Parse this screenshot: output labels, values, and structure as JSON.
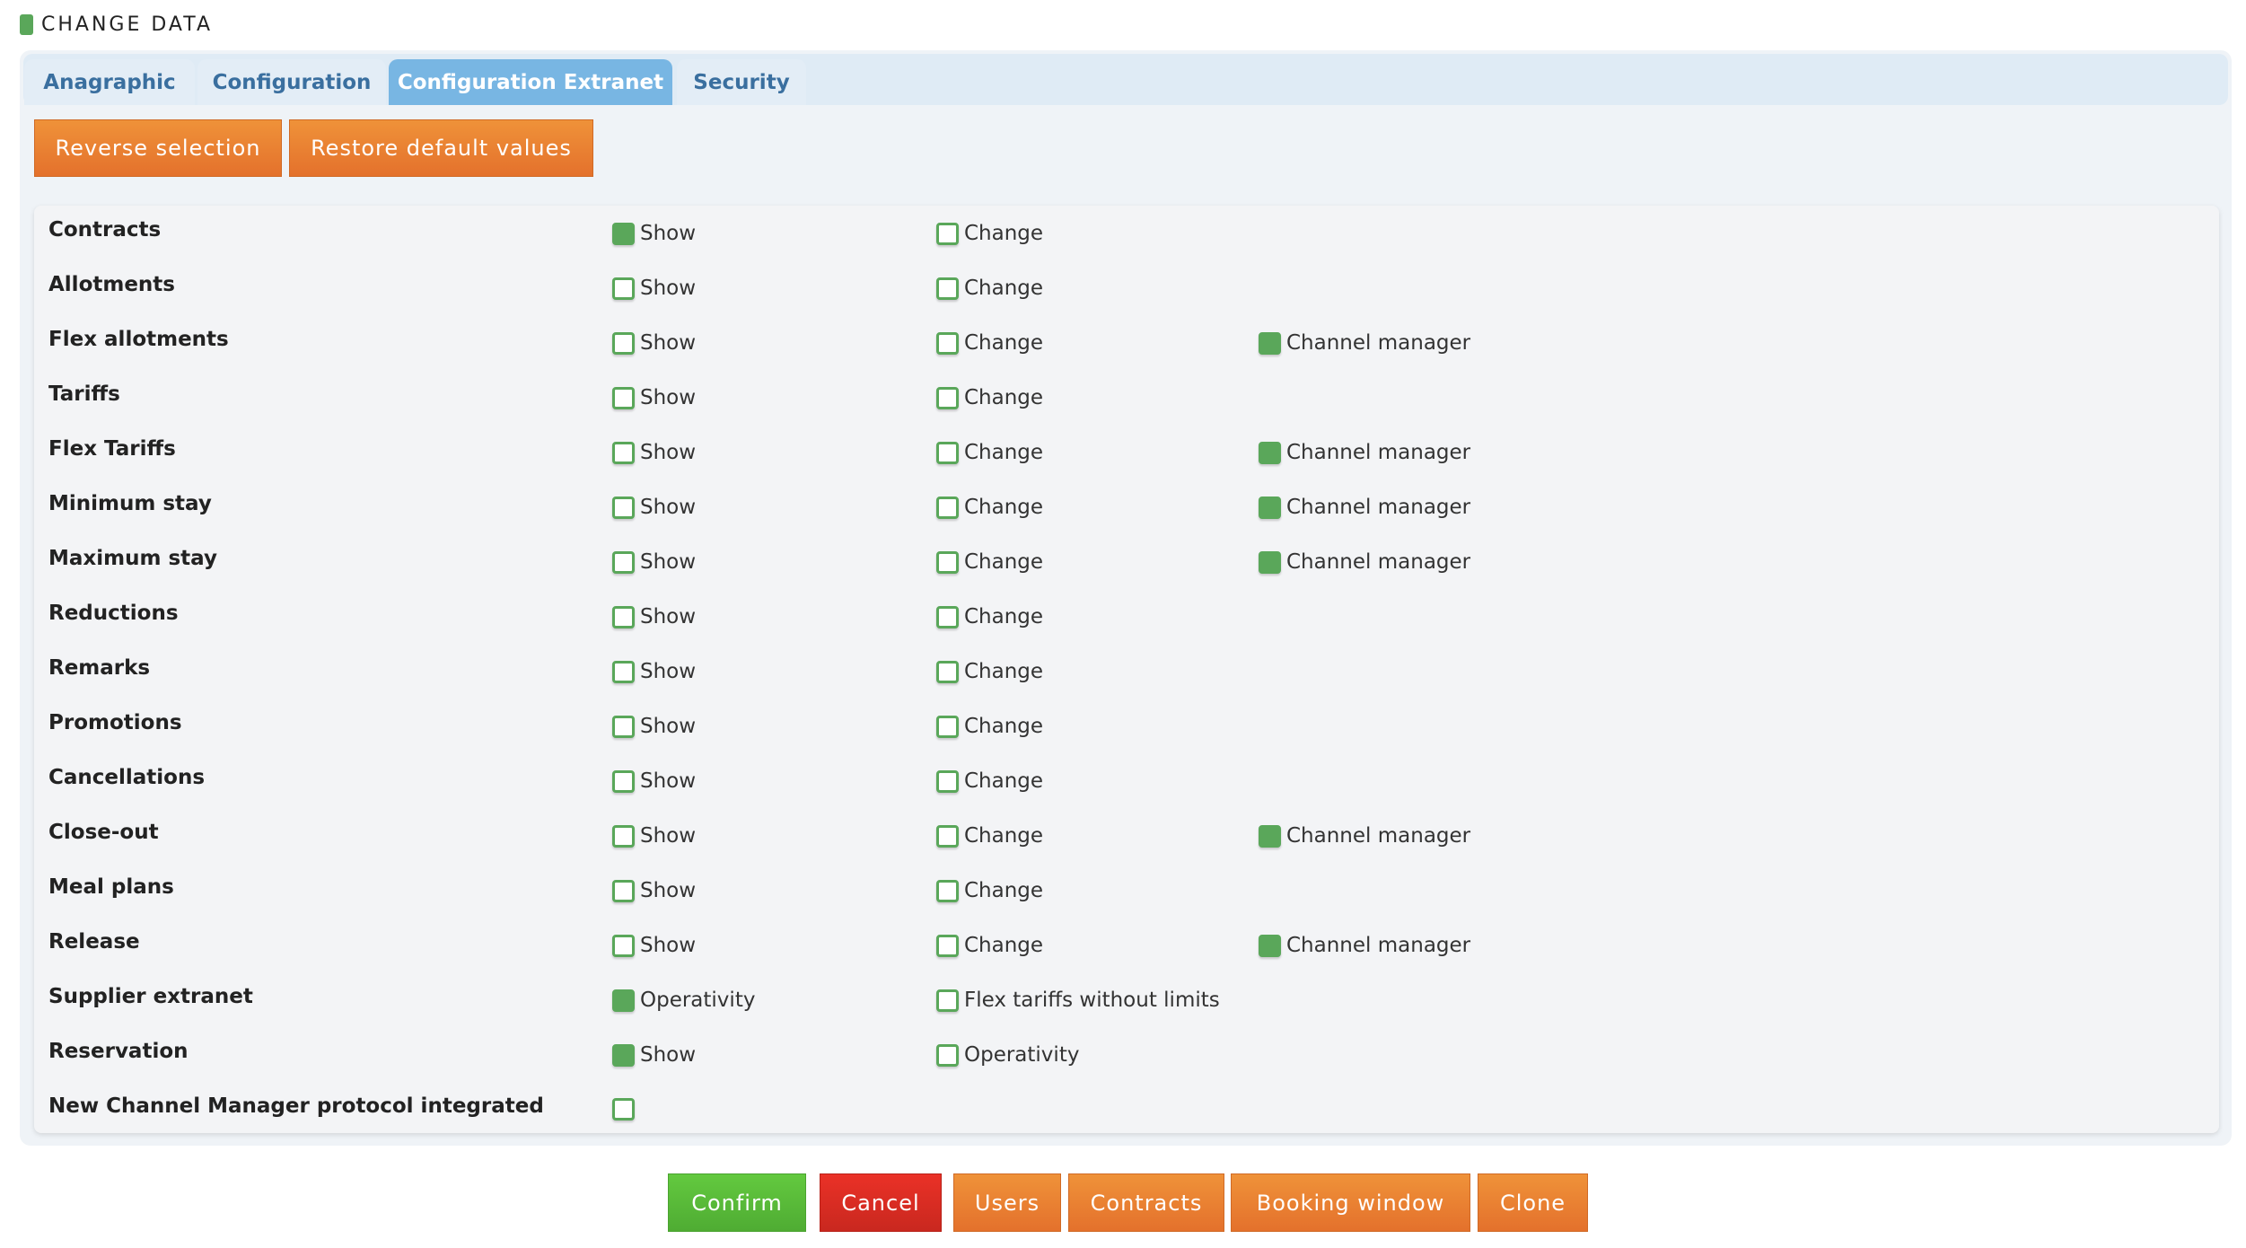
{
  "header": {
    "title": "CHANGE DATA"
  },
  "tabs": [
    {
      "label": "Anagraphic",
      "active": false
    },
    {
      "label": "Configuration",
      "active": false
    },
    {
      "label": "Configuration Extranet",
      "active": true
    },
    {
      "label": "Security",
      "active": false
    }
  ],
  "toolbar": {
    "reverse_selection": "Reverse selection",
    "restore_defaults": "Restore default values"
  },
  "colors": {
    "checkbox": "#5aa75a",
    "tab_active": "#78b6e3",
    "orange": "#e98130",
    "confirm": "#55b737",
    "cancel": "#d62b22"
  },
  "rows": [
    {
      "label": "Contracts",
      "options": [
        {
          "label": "Show",
          "checked": true
        },
        {
          "label": "Change",
          "checked": false
        }
      ]
    },
    {
      "label": "Allotments",
      "options": [
        {
          "label": "Show",
          "checked": false
        },
        {
          "label": "Change",
          "checked": false
        }
      ]
    },
    {
      "label": "Flex allotments",
      "options": [
        {
          "label": "Show",
          "checked": false
        },
        {
          "label": "Change",
          "checked": false
        },
        {
          "label": "Channel manager",
          "checked": true
        }
      ]
    },
    {
      "label": "Tariffs",
      "options": [
        {
          "label": "Show",
          "checked": false
        },
        {
          "label": "Change",
          "checked": false
        }
      ]
    },
    {
      "label": "Flex Tariffs",
      "options": [
        {
          "label": "Show",
          "checked": false
        },
        {
          "label": "Change",
          "checked": false
        },
        {
          "label": "Channel manager",
          "checked": true
        }
      ]
    },
    {
      "label": "Minimum stay",
      "options": [
        {
          "label": "Show",
          "checked": false
        },
        {
          "label": "Change",
          "checked": false
        },
        {
          "label": "Channel manager",
          "checked": true
        }
      ]
    },
    {
      "label": "Maximum stay",
      "options": [
        {
          "label": "Show",
          "checked": false
        },
        {
          "label": "Change",
          "checked": false
        },
        {
          "label": "Channel manager",
          "checked": true
        }
      ]
    },
    {
      "label": "Reductions",
      "options": [
        {
          "label": "Show",
          "checked": false
        },
        {
          "label": "Change",
          "checked": false
        }
      ]
    },
    {
      "label": "Remarks",
      "options": [
        {
          "label": "Show",
          "checked": false
        },
        {
          "label": "Change",
          "checked": false
        }
      ]
    },
    {
      "label": "Promotions",
      "options": [
        {
          "label": "Show",
          "checked": false
        },
        {
          "label": "Change",
          "checked": false
        }
      ]
    },
    {
      "label": "Cancellations",
      "options": [
        {
          "label": "Show",
          "checked": false
        },
        {
          "label": "Change",
          "checked": false
        }
      ]
    },
    {
      "label": "Close-out",
      "options": [
        {
          "label": "Show",
          "checked": false
        },
        {
          "label": "Change",
          "checked": false
        },
        {
          "label": "Channel manager",
          "checked": true
        }
      ]
    },
    {
      "label": "Meal plans",
      "options": [
        {
          "label": "Show",
          "checked": false
        },
        {
          "label": "Change",
          "checked": false
        }
      ]
    },
    {
      "label": "Release",
      "options": [
        {
          "label": "Show",
          "checked": false
        },
        {
          "label": "Change",
          "checked": false
        },
        {
          "label": "Channel manager",
          "checked": true
        }
      ]
    },
    {
      "label": "Supplier extranet",
      "options": [
        {
          "label": "Operativity",
          "checked": true
        },
        {
          "label": "Flex tariffs without limits",
          "checked": false
        }
      ]
    },
    {
      "label": "Reservation",
      "options": [
        {
          "label": "Show",
          "checked": true
        },
        {
          "label": "Operativity",
          "checked": false
        }
      ]
    },
    {
      "label": "New Channel Manager protocol integrated",
      "options": [
        {
          "label": "",
          "checked": false
        }
      ]
    }
  ],
  "footer": {
    "confirm": "Confirm",
    "cancel": "Cancel",
    "users": "Users",
    "contracts": "Contracts",
    "booking_window": "Booking window",
    "clone": "Clone"
  }
}
